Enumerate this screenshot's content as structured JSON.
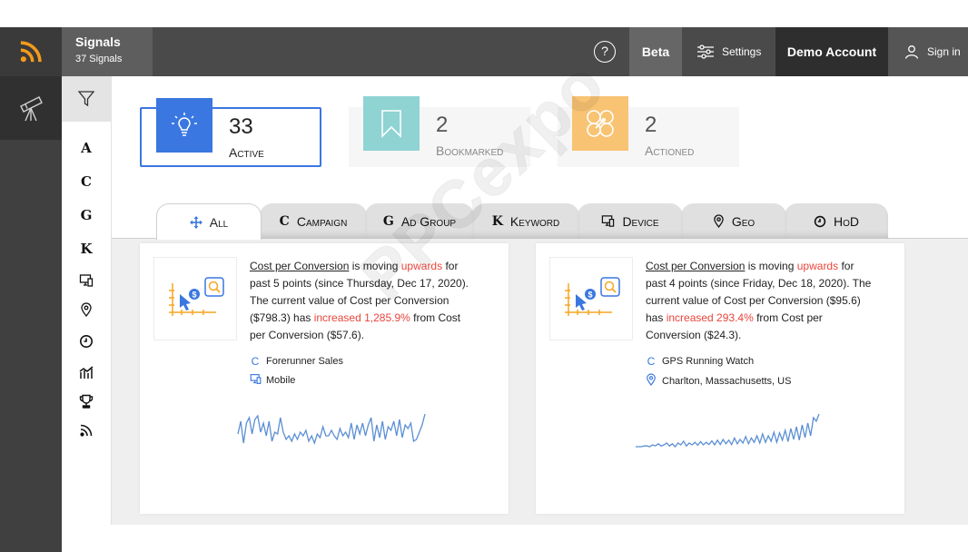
{
  "app": {
    "title": "Signals",
    "subtitle": "37 Signals",
    "help_label": "?",
    "beta_label": "Beta",
    "settings_label": "Settings",
    "account_label": "Demo Account",
    "signin_label": "Sign in",
    "accent_color": "#3a77e0",
    "logo_color": "#f59a1b"
  },
  "filters": {
    "items": [
      {
        "label": "A",
        "icon": "letter-a"
      },
      {
        "label": "C",
        "icon": "letter-c"
      },
      {
        "label": "G",
        "icon": "letter-g"
      },
      {
        "label": "K",
        "icon": "letter-k"
      },
      {
        "label": "",
        "icon": "device-icon"
      },
      {
        "label": "",
        "icon": "location-pin-icon"
      },
      {
        "label": "",
        "icon": "clock-icon"
      },
      {
        "label": "",
        "icon": "bar-chart-icon"
      },
      {
        "label": "",
        "icon": "trophy-icon"
      },
      {
        "label": "",
        "icon": "rss-icon"
      }
    ]
  },
  "stats": [
    {
      "count": "33",
      "label": "Active",
      "icon": "lightbulb-icon",
      "color": "#3a77e0"
    },
    {
      "count": "2",
      "label": "Bookmarked",
      "icon": "bookmark-icon",
      "color": "#8fd3d3"
    },
    {
      "count": "2",
      "label": "Actioned",
      "icon": "actioned-icon",
      "color": "#f8c373"
    }
  ],
  "tabs": [
    {
      "key": "",
      "label": "All",
      "icon": "move-icon"
    },
    {
      "key": "C",
      "label": "Campaign"
    },
    {
      "key": "G",
      "label": "Ad Group"
    },
    {
      "key": "K",
      "label": "Keyword"
    },
    {
      "key": "",
      "label": "Device",
      "icon": "device-icon"
    },
    {
      "key": "",
      "label": "Geo",
      "icon": "location-pin-icon"
    },
    {
      "key": "",
      "label": "HoD",
      "icon": "clock-icon"
    }
  ],
  "watermark": "PPCexpo",
  "cards": [
    {
      "metric": "Cost per Conversion",
      "t1": " is moving ",
      "direction": "upwards",
      "t2": " for past 5 points (since Thursday, Dec 17, 2020). The current value of Cost per Conversion ($798.3) has ",
      "change": "increased 1,285.9%",
      "t3": " from Cost per Conversion ($57.6).",
      "meta1_icon": "C",
      "meta1": "Forerunner Sales",
      "meta2": "Mobile",
      "meta2_icon": "device-icon",
      "sparkline": [
        0.55,
        0.2,
        0.8,
        0.25,
        0.1,
        0.55,
        0.15,
        0.05,
        0.5,
        0.25,
        0.6,
        0.2,
        0.75,
        0.5,
        0.55,
        0.1,
        0.5,
        0.7,
        0.6,
        0.75,
        0.55,
        0.7,
        0.5,
        0.6,
        0.45,
        0.75,
        0.6,
        0.8,
        0.55,
        0.65,
        0.35,
        0.6,
        0.6,
        0.45,
        0.6,
        0.7,
        0.4,
        0.6,
        0.5,
        0.65,
        0.25,
        0.7,
        0.3,
        0.55,
        0.25,
        0.6,
        0.3,
        0.1,
        0.75,
        0.3,
        0.65,
        0.2,
        0.7,
        0.35,
        0.45,
        0.2,
        0.6,
        0.15,
        0.65,
        0.3,
        0.4,
        0.25,
        0.75,
        0.7,
        0.5,
        0.3,
        0.0
      ]
    },
    {
      "metric": "Cost per Conversion",
      "t1": " is moving ",
      "direction": "upwards",
      "t2": " for past 4 points (since Friday, Dec 18, 2020). The current value of Cost per Conversion ($95.6) has ",
      "change": "increased 293.4%",
      "t3": " from Cost per Conversion ($24.3).",
      "meta1_icon": "C",
      "meta1": "GPS Running Watch",
      "meta2": "Charlton, Massachusetts, US",
      "meta2_icon": "location-pin-icon",
      "sparkline": [
        0.9,
        0.9,
        0.9,
        0.88,
        0.88,
        0.9,
        0.85,
        0.88,
        0.82,
        0.88,
        0.85,
        0.8,
        0.88,
        0.82,
        0.9,
        0.8,
        0.85,
        0.75,
        0.88,
        0.8,
        0.85,
        0.78,
        0.86,
        0.76,
        0.85,
        0.78,
        0.84,
        0.74,
        0.85,
        0.72,
        0.84,
        0.7,
        0.82,
        0.72,
        0.84,
        0.66,
        0.82,
        0.7,
        0.8,
        0.62,
        0.82,
        0.66,
        0.78,
        0.6,
        0.8,
        0.55,
        0.78,
        0.6,
        0.75,
        0.5,
        0.78,
        0.52,
        0.72,
        0.45,
        0.76,
        0.4,
        0.7,
        0.35,
        0.72,
        0.3,
        0.65,
        0.25,
        0.6,
        0.1,
        0.2,
        0.0
      ]
    }
  ]
}
